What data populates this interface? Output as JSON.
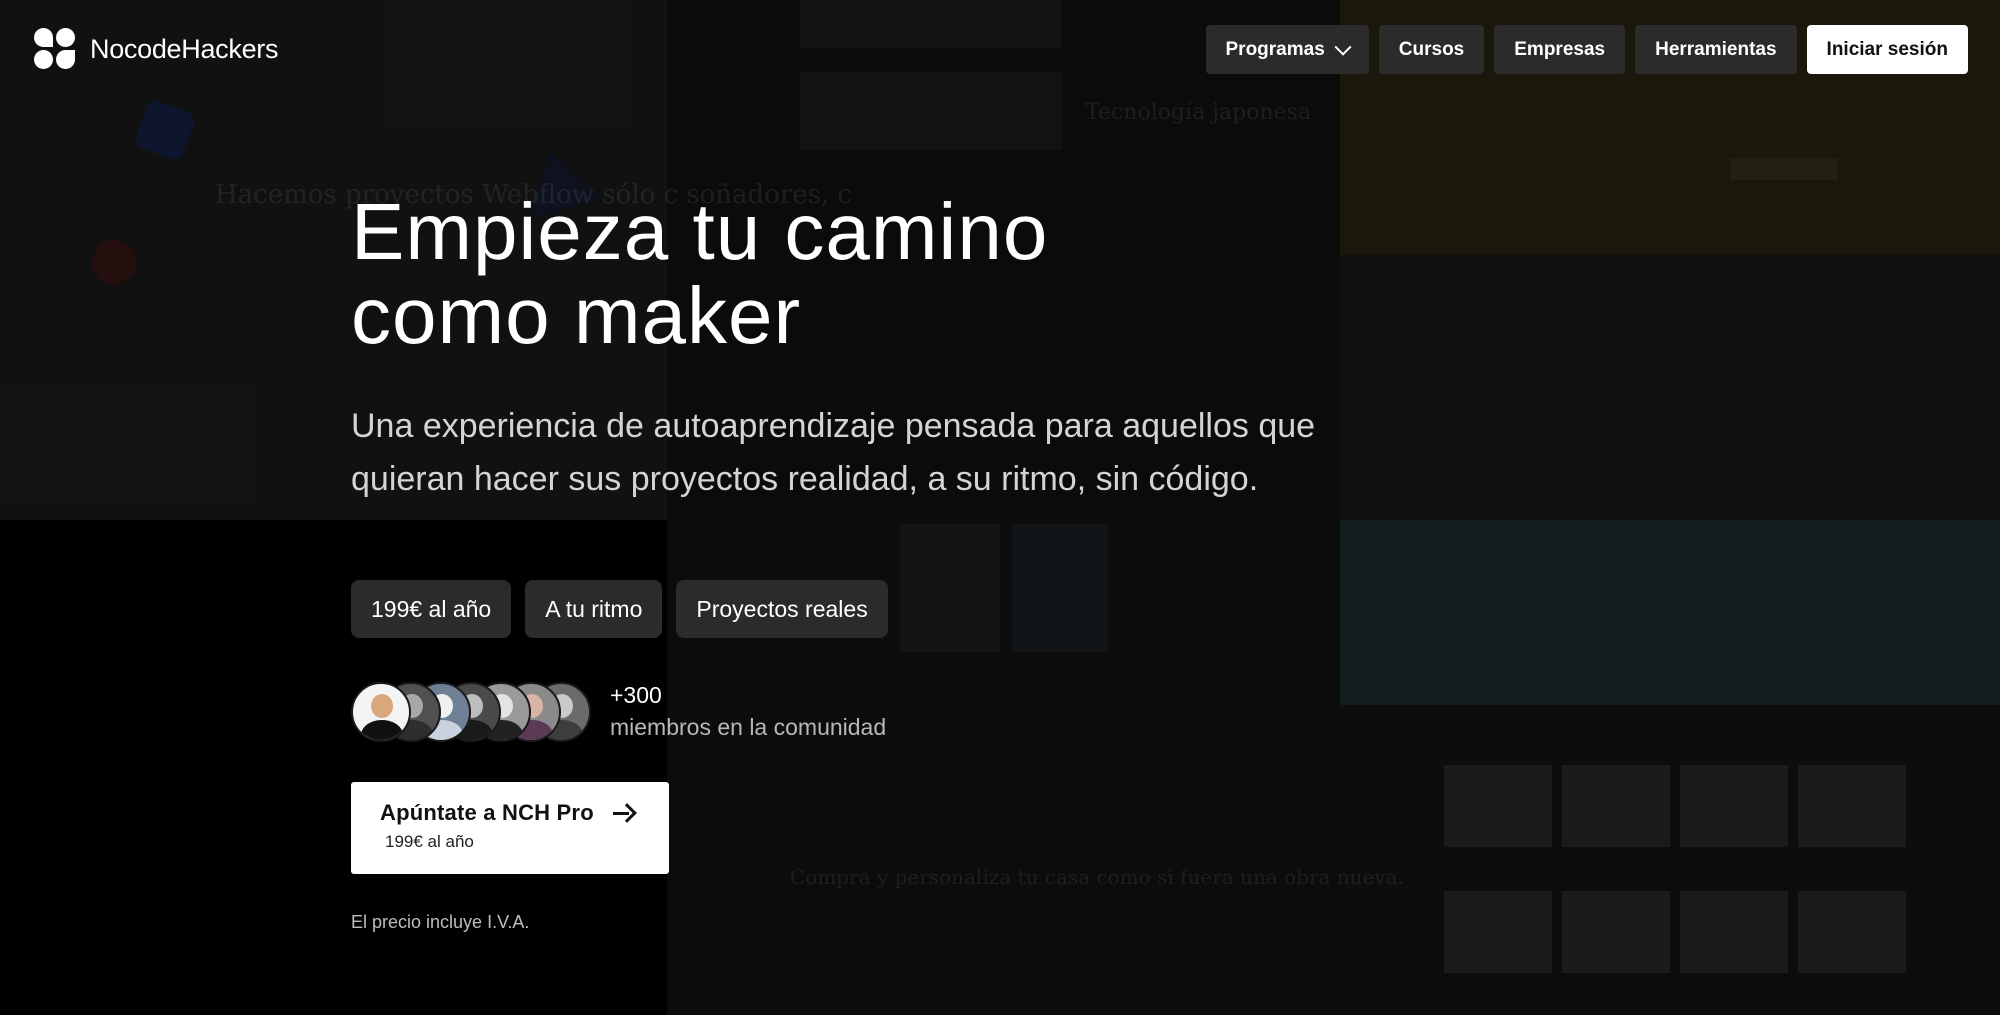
{
  "brand": {
    "name": "NocodeHackers"
  },
  "nav": {
    "items": [
      {
        "label": "Programas",
        "has_dropdown": true,
        "icon": "chevron-down-icon"
      },
      {
        "label": "Cursos"
      },
      {
        "label": "Empresas"
      },
      {
        "label": "Herramientas"
      }
    ],
    "login_label": "Iniciar sesión"
  },
  "hero": {
    "title_line1": "Empieza tu camino",
    "title_line2": "como maker",
    "subtitle": "Una experiencia de autoaprendizaje pensada para aquellos que quieran hacer sus proyectos realidad, a su ritmo, sin código."
  },
  "pills": [
    "199€ al año",
    "A tu ritmo",
    "Proyectos reales"
  ],
  "community": {
    "count": "+300",
    "label": "miembros en la comunidad",
    "avatars": 7
  },
  "cta": {
    "title": "Apúntate a NCH Pro",
    "price": "199€ al año",
    "icon": "arrow-right-icon"
  },
  "footnote": "El precio incluye I.V.A.",
  "background_text": {
    "left_heading": "Hacemos proyectos Webflow sólo c soñadores, c",
    "mid_heading": "Tecnología japonesa",
    "bottom_heading": "Compra y personaliza tu casa como si fuera una obra nueva."
  },
  "colors": {
    "background": "#0b0b0b",
    "pill_bg": "#2b2b2b",
    "cta_bg": "#ffffff",
    "text_primary": "#ffffff",
    "text_muted": "#b8b8b8"
  }
}
